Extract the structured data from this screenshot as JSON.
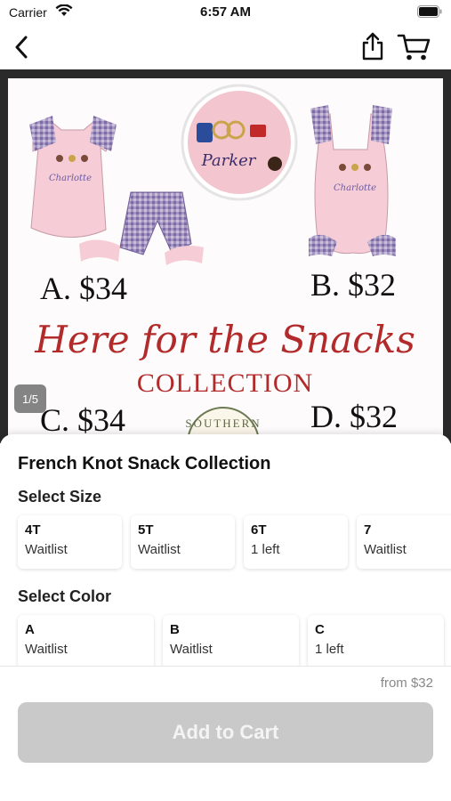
{
  "status_bar": {
    "carrier": "Carrier",
    "time": "6:57 AM",
    "icons": [
      "wifi-icon",
      "battery-icon"
    ]
  },
  "nav": {
    "icons": [
      "chevron-left-icon",
      "share-icon",
      "cart-icon"
    ]
  },
  "gallery": {
    "page_indicator": "1/5",
    "image": {
      "price_labels": [
        "A. $34",
        "B. $32",
        "C. $34",
        "D. $32"
      ],
      "headline_script": "Here for the Snacks",
      "headline_caps": "COLLECTION",
      "embroidered_name_a": "Charlotte",
      "embroidered_name_b": "Charlotte",
      "embroidered_name_patch": "Parker",
      "badge_text": "SOUTHERN",
      "colors": {
        "pink": "#f6cdd6",
        "gingham": "#8e7bb0",
        "script_red": "#b22a2a"
      }
    }
  },
  "product": {
    "title": "French Knot Snack Collection",
    "size_heading": "Select Size",
    "sizes": [
      {
        "name": "4T",
        "status": "Waitlist"
      },
      {
        "name": "5T",
        "status": "Waitlist"
      },
      {
        "name": "6T",
        "status": "1 left"
      },
      {
        "name": "7",
        "status": "Waitlist"
      }
    ],
    "color_heading": "Select Color",
    "colors": [
      {
        "name": "A",
        "status": "Waitlist"
      },
      {
        "name": "B",
        "status": "Waitlist"
      },
      {
        "name": "C",
        "status": "1 left"
      }
    ]
  },
  "footer": {
    "price_from": "from $32",
    "add_to_cart_label": "Add to Cart",
    "button_color": "#c9c9c9"
  }
}
